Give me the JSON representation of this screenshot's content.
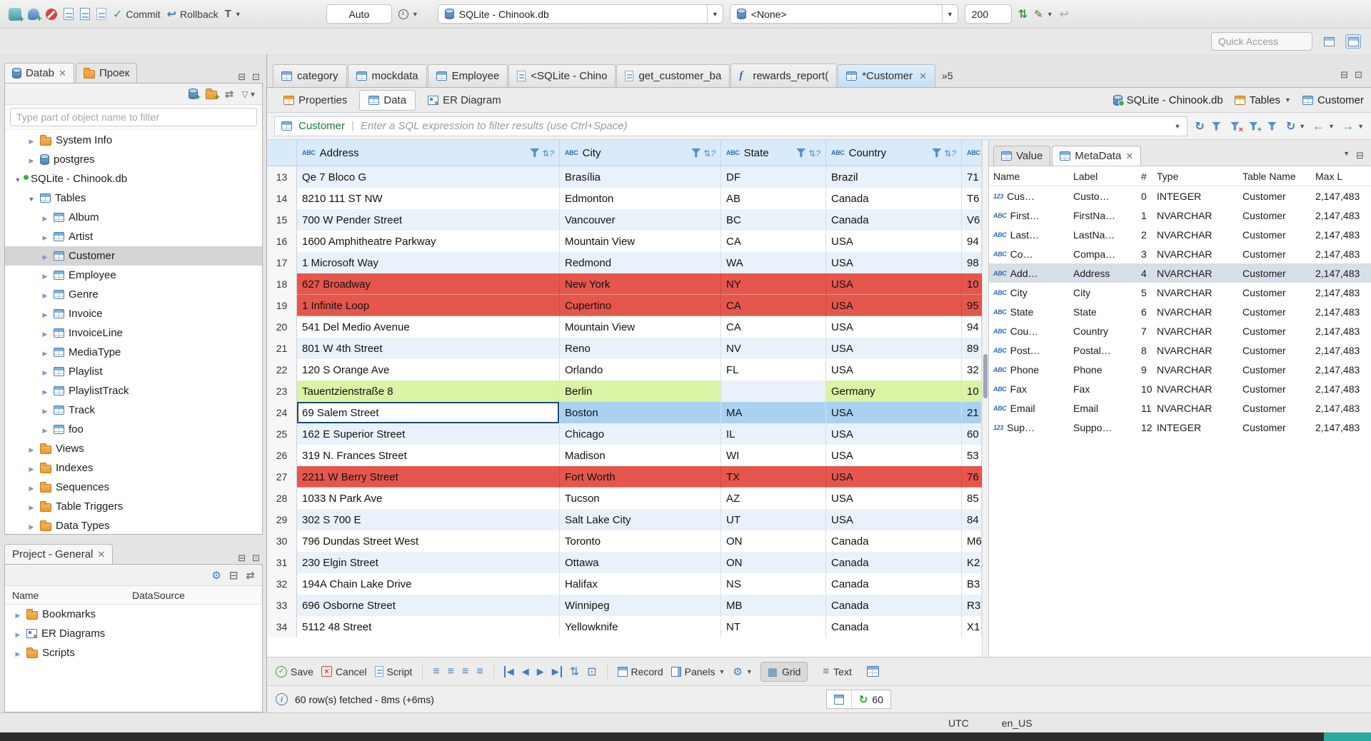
{
  "topbar": {
    "commit_label": "Commit",
    "rollback_label": "Rollback",
    "auto_combo_value": "Auto",
    "db_combo_value": "SQLite - Chinook.db",
    "schema_combo_value": "<None>",
    "fetch_size_value": "200",
    "quick_access_placeholder": "Quick Access"
  },
  "navigator": {
    "tab_database_label": "Datab",
    "tab_projects_label": "Проек",
    "filter_placeholder": "Type part of object name to filter",
    "tree": [
      {
        "label": "System Info",
        "indent": "1",
        "icon": "folder",
        "arrow": "right"
      },
      {
        "label": "postgres",
        "indent": "1",
        "icon": "db",
        "arrow": "right"
      },
      {
        "label": "SQLite - Chinook.db",
        "indent": "0",
        "icon": "dbc",
        "arrow": "down"
      },
      {
        "label": "Tables",
        "indent": "1",
        "icon": "table",
        "arrow": "down"
      },
      {
        "label": "Album",
        "indent": "2",
        "icon": "table",
        "arrow": "right"
      },
      {
        "label": "Artist",
        "indent": "2",
        "icon": "table",
        "arrow": "right"
      },
      {
        "label": "Customer",
        "indent": "2",
        "icon": "table",
        "arrow": "right",
        "selected": true
      },
      {
        "label": "Employee",
        "indent": "2",
        "icon": "table",
        "arrow": "right"
      },
      {
        "label": "Genre",
        "indent": "2",
        "icon": "table",
        "arrow": "right"
      },
      {
        "label": "Invoice",
        "indent": "2",
        "icon": "table",
        "arrow": "right"
      },
      {
        "label": "InvoiceLine",
        "indent": "2",
        "icon": "table",
        "arrow": "right"
      },
      {
        "label": "MediaType",
        "indent": "2",
        "icon": "table",
        "arrow": "right"
      },
      {
        "label": "Playlist",
        "indent": "2",
        "icon": "table",
        "arrow": "right"
      },
      {
        "label": "PlaylistTrack",
        "indent": "2",
        "icon": "table",
        "arrow": "right"
      },
      {
        "label": "Track",
        "indent": "2",
        "icon": "table",
        "arrow": "right"
      },
      {
        "label": "foo",
        "indent": "2",
        "icon": "table",
        "arrow": "right"
      },
      {
        "label": "Views",
        "indent": "1",
        "icon": "folder",
        "arrow": "right"
      },
      {
        "label": "Indexes",
        "indent": "1",
        "icon": "folder",
        "arrow": "right"
      },
      {
        "label": "Sequences",
        "indent": "1",
        "icon": "folder",
        "arrow": "right"
      },
      {
        "label": "Table Triggers",
        "indent": "1",
        "icon": "folder",
        "arrow": "right"
      },
      {
        "label": "Data Types",
        "indent": "1",
        "icon": "folder",
        "arrow": "right"
      }
    ]
  },
  "project_panel": {
    "title": "Project - General",
    "col_name": "Name",
    "col_datasource": "DataSource",
    "items": [
      {
        "label": "Bookmarks",
        "icon": "folder"
      },
      {
        "label": "ER Diagrams",
        "icon": "er"
      },
      {
        "label": "Scripts",
        "icon": "folder"
      }
    ]
  },
  "editor": {
    "tabs": [
      {
        "label": "category",
        "icon": "table"
      },
      {
        "label": "mockdata",
        "icon": "table"
      },
      {
        "label": "Employee",
        "icon": "table"
      },
      {
        "label": "<SQLite - Chino",
        "icon": "sql"
      },
      {
        "label": "get_customer_ba",
        "icon": "sql"
      },
      {
        "label": "rewards_report(",
        "icon": "fn"
      },
      {
        "label": "*Customer",
        "icon": "table",
        "active": true
      }
    ],
    "overflow_label": "»5",
    "subtabs": {
      "properties": "Properties",
      "data": "Data",
      "er": "ER Diagram"
    },
    "breadcrumb": {
      "db": "SQLite - Chinook.db",
      "tables": "Tables",
      "table": "Customer"
    }
  },
  "filterbar": {
    "table_name": "Customer",
    "input_placeholder": "Enter a SQL expression to filter results (use Ctrl+Space)"
  },
  "grid": {
    "columns": {
      "address": "Address",
      "city": "City",
      "state": "State",
      "country": "Country"
    },
    "rows": [
      {
        "n": "13",
        "a": "Qe 7 Bloco G",
        "c": "Brasília",
        "s": "DF",
        "co": "Brazil",
        "x": "71",
        "hl": ""
      },
      {
        "n": "14",
        "a": "8210 111 ST NW",
        "c": "Edmonton",
        "s": "AB",
        "co": "Canada",
        "x": "T6",
        "hl": ""
      },
      {
        "n": "15",
        "a": "700 W Pender Street",
        "c": "Vancouver",
        "s": "BC",
        "co": "Canada",
        "x": "V6",
        "hl": ""
      },
      {
        "n": "16",
        "a": "1600 Amphitheatre Parkway",
        "c": "Mountain View",
        "s": "CA",
        "co": "USA",
        "x": "94",
        "hl": ""
      },
      {
        "n": "17",
        "a": "1 Microsoft Way",
        "c": "Redmond",
        "s": "WA",
        "co": "USA",
        "x": "98",
        "hl": ""
      },
      {
        "n": "18",
        "a": "627 Broadway",
        "c": "New York",
        "s": "NY",
        "co": "USA",
        "x": "10",
        "hl": "red"
      },
      {
        "n": "19",
        "a": "1 Infinite Loop",
        "c": "Cupertino",
        "s": "CA",
        "co": "USA",
        "x": "95",
        "hl": "red"
      },
      {
        "n": "20",
        "a": "541 Del Medio Avenue",
        "c": "Mountain View",
        "s": "CA",
        "co": "USA",
        "x": "94",
        "hl": ""
      },
      {
        "n": "21",
        "a": "801 W 4th Street",
        "c": "Reno",
        "s": "NV",
        "co": "USA",
        "x": "89",
        "hl": ""
      },
      {
        "n": "22",
        "a": "120 S Orange Ave",
        "c": "Orlando",
        "s": "FL",
        "co": "USA",
        "x": "32",
        "hl": ""
      },
      {
        "n": "23",
        "a": "Tauentzienstraße 8",
        "c": "Berlin",
        "s": "",
        "co": "Germany",
        "x": "10",
        "hl": "green"
      },
      {
        "n": "24",
        "a": "69 Salem Street",
        "c": "Boston",
        "s": "MA",
        "co": "USA",
        "x": "21",
        "hl": "sel"
      },
      {
        "n": "25",
        "a": "162 E Superior Street",
        "c": "Chicago",
        "s": "IL",
        "co": "USA",
        "x": "60",
        "hl": ""
      },
      {
        "n": "26",
        "a": "319 N. Frances Street",
        "c": "Madison",
        "s": "WI",
        "co": "USA",
        "x": "53",
        "hl": ""
      },
      {
        "n": "27",
        "a": "2211 W Berry Street",
        "c": "Fort Worth",
        "s": "TX",
        "co": "USA",
        "x": "76",
        "hl": "red"
      },
      {
        "n": "28",
        "a": "1033 N Park Ave",
        "c": "Tucson",
        "s": "AZ",
        "co": "USA",
        "x": "85",
        "hl": ""
      },
      {
        "n": "29",
        "a": "302 S 700 E",
        "c": "Salt Lake City",
        "s": "UT",
        "co": "USA",
        "x": "84",
        "hl": ""
      },
      {
        "n": "30",
        "a": "796 Dundas Street West",
        "c": "Toronto",
        "s": "ON",
        "co": "Canada",
        "x": "M6",
        "hl": ""
      },
      {
        "n": "31",
        "a": "230 Elgin Street",
        "c": "Ottawa",
        "s": "ON",
        "co": "Canada",
        "x": "K2",
        "hl": ""
      },
      {
        "n": "32",
        "a": "194A Chain Lake Drive",
        "c": "Halifax",
        "s": "NS",
        "co": "Canada",
        "x": "B3",
        "hl": ""
      },
      {
        "n": "33",
        "a": "696 Osborne Street",
        "c": "Winnipeg",
        "s": "MB",
        "co": "Canada",
        "x": "R3",
        "hl": ""
      },
      {
        "n": "34",
        "a": "5112 48 Street",
        "c": "Yellowknife",
        "s": "NT",
        "co": "Canada",
        "x": "X1",
        "hl": ""
      }
    ]
  },
  "side_panel": {
    "tab_value_label": "Value",
    "tab_metadata_label": "MetaData",
    "columns": {
      "name": "Name",
      "label": "Label",
      "num": "#",
      "type": "Type",
      "table": "Table Name",
      "max": "Max L"
    },
    "rows": [
      {
        "icon": "123",
        "name": "Cus…",
        "label": "Custo…",
        "num": "0",
        "type": "INTEGER",
        "table": "Customer",
        "max": "2,147,483"
      },
      {
        "icon": "ABC",
        "name": "First…",
        "label": "FirstNa…",
        "num": "1",
        "type": "NVARCHAR",
        "table": "Customer",
        "max": "2,147,483"
      },
      {
        "icon": "ABC",
        "name": "Last…",
        "label": "LastNa…",
        "num": "2",
        "type": "NVARCHAR",
        "table": "Customer",
        "max": "2,147,483"
      },
      {
        "icon": "ABC",
        "name": "Co…",
        "label": "Compa…",
        "num": "3",
        "type": "NVARCHAR",
        "table": "Customer",
        "max": "2,147,483"
      },
      {
        "icon": "ABC",
        "name": "Add…",
        "label": "Address",
        "num": "4",
        "type": "NVARCHAR",
        "table": "Customer",
        "max": "2,147,483",
        "selected": true
      },
      {
        "icon": "ABC",
        "name": "City",
        "label": "City",
        "num": "5",
        "type": "NVARCHAR",
        "table": "Customer",
        "max": "2,147,483"
      },
      {
        "icon": "ABC",
        "name": "State",
        "label": "State",
        "num": "6",
        "type": "NVARCHAR",
        "table": "Customer",
        "max": "2,147,483"
      },
      {
        "icon": "ABC",
        "name": "Cou…",
        "label": "Country",
        "num": "7",
        "type": "NVARCHAR",
        "table": "Customer",
        "max": "2,147,483"
      },
      {
        "icon": "ABC",
        "name": "Post…",
        "label": "Postal…",
        "num": "8",
        "type": "NVARCHAR",
        "table": "Customer",
        "max": "2,147,483"
      },
      {
        "icon": "ABC",
        "name": "Phone",
        "label": "Phone",
        "num": "9",
        "type": "NVARCHAR",
        "table": "Customer",
        "max": "2,147,483"
      },
      {
        "icon": "ABC",
        "name": "Fax",
        "label": "Fax",
        "num": "10",
        "type": "NVARCHAR",
        "table": "Customer",
        "max": "2,147,483"
      },
      {
        "icon": "ABC",
        "name": "Email",
        "label": "Email",
        "num": "11",
        "type": "NVARCHAR",
        "table": "Customer",
        "max": "2,147,483"
      },
      {
        "icon": "123",
        "name": "Sup…",
        "label": "Suppo…",
        "num": "12",
        "type": "INTEGER",
        "table": "Customer",
        "max": "2,147,483"
      }
    ]
  },
  "result_toolbar": {
    "save": "Save",
    "cancel": "Cancel",
    "script": "Script",
    "record": "Record",
    "panels": "Panels",
    "grid": "Grid",
    "text": "Text"
  },
  "status_row": {
    "message": "60 row(s) fetched - 8ms (+6ms)",
    "refresh_count": "60"
  },
  "statusbar": {
    "timezone": "UTC",
    "locale": "en_US"
  }
}
